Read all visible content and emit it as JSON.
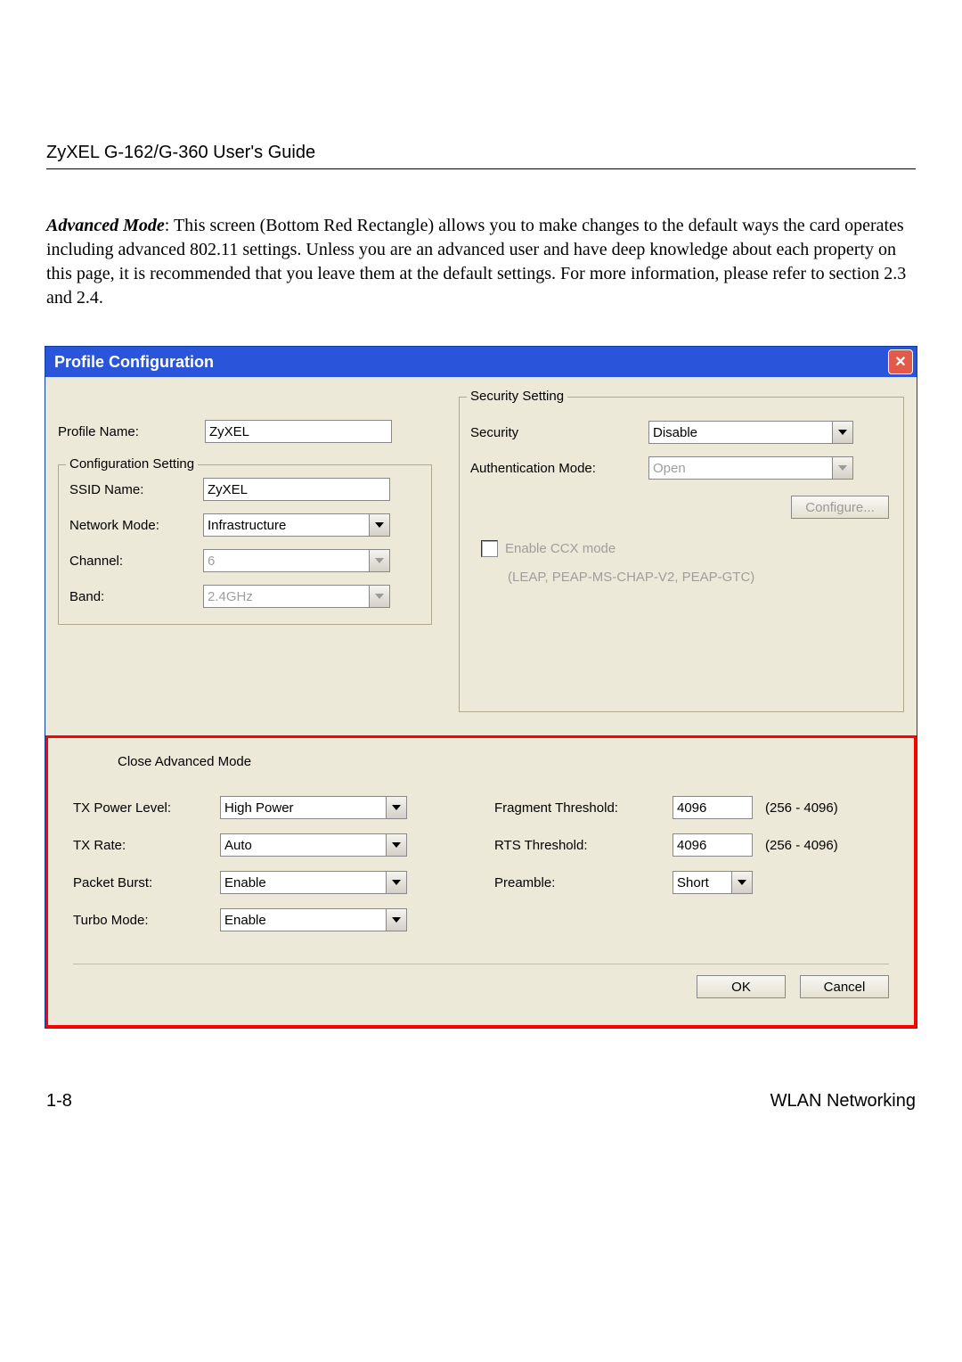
{
  "doc": {
    "header": "ZyXEL G-162/G-360 User's Guide",
    "para_lead": "Advanced Mode",
    "para_body": ": This screen (Bottom Red Rectangle) allows you to make changes to the default ways the card operates including advanced 802.11 settings.  Unless you are an advanced user and have deep knowledge about each property on this page, it is recommended that you leave them at the default settings.  For more information, please refer to section 2.3 and 2.4.",
    "page_num": "1-8",
    "footer_right": "WLAN Networking"
  },
  "win": {
    "title": "Profile Configuration",
    "close_x": "✕",
    "left": {
      "profile_name_label": "Profile Name:",
      "profile_name_value": "ZyXEL",
      "config_legend": "Configuration Setting",
      "ssid_label": "SSID Name:",
      "ssid_value": "ZyXEL",
      "netmode_label": "Network Mode:",
      "netmode_value": "Infrastructure",
      "channel_label": "Channel:",
      "channel_value": "6",
      "band_label": "Band:",
      "band_value": "2.4GHz"
    },
    "right": {
      "sec_legend": "Security Setting",
      "security_label": "Security",
      "security_value": "Disable",
      "auth_label": "Authentication Mode:",
      "auth_value": "Open",
      "configure_btn": "Configure...",
      "ccx_label": "Enable CCX mode",
      "ccx_sub": "(LEAP, PEAP-MS-CHAP-V2, PEAP-GTC)"
    },
    "adv": {
      "close_label": "Close Advanced Mode",
      "tx_power_label": "TX Power Level:",
      "tx_power_value": "High Power",
      "tx_rate_label": "TX Rate:",
      "tx_rate_value": "Auto",
      "packet_burst_label": "Packet Burst:",
      "packet_burst_value": "Enable",
      "turbo_label": "Turbo Mode:",
      "turbo_value": "Enable",
      "frag_label": "Fragment Threshold:",
      "frag_value": "4096",
      "frag_range": "(256 - 4096)",
      "rts_label": "RTS Threshold:",
      "rts_value": "4096",
      "rts_range": "(256 - 4096)",
      "preamble_label": "Preamble:",
      "preamble_value": "Short"
    },
    "ok": "OK",
    "cancel": "Cancel"
  }
}
